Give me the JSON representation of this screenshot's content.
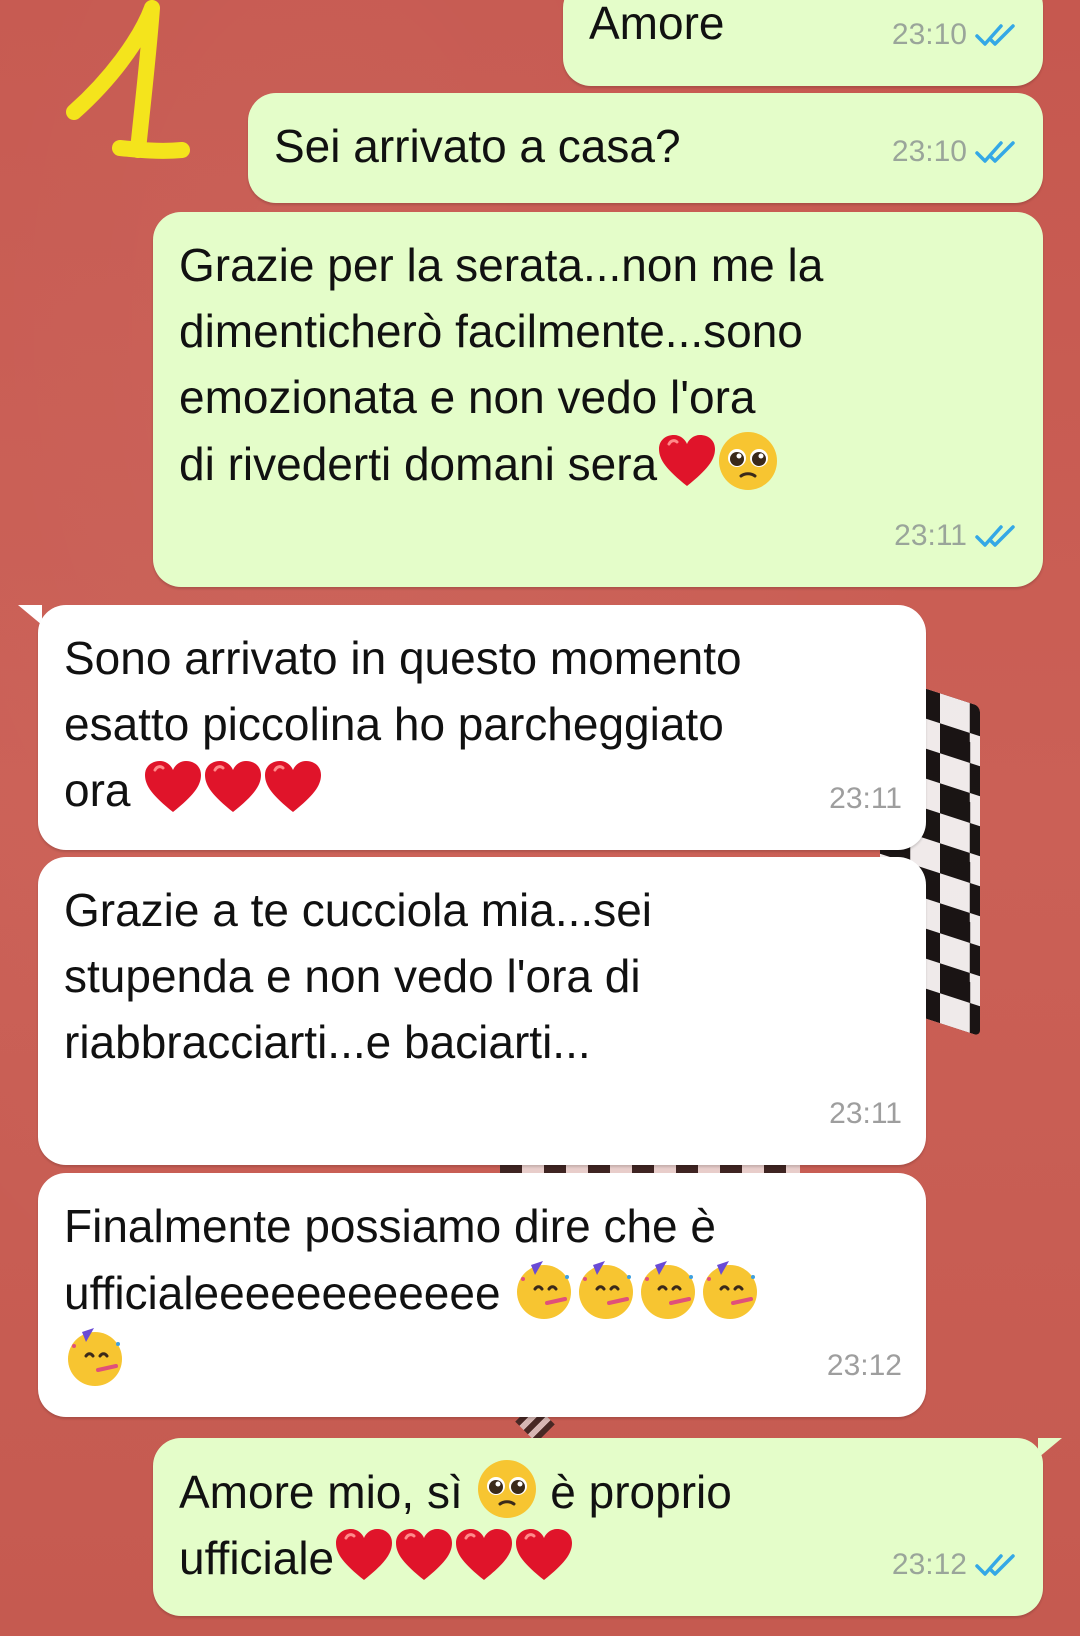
{
  "annotation": {
    "label": "1",
    "color": "#f4e41c"
  },
  "colors": {
    "background": "#c95f55",
    "outgoing_bubble": "#e4fdc9",
    "incoming_bubble": "#ffffff",
    "read_ticks": "#34a8e6"
  },
  "messages": [
    {
      "direction": "out",
      "text": "Amore",
      "time": "23:10",
      "status": "read"
    },
    {
      "direction": "out",
      "text": "Sei arrivato a casa?",
      "time": "23:10",
      "status": "read"
    },
    {
      "direction": "out",
      "lines": [
        "Grazie per la serata...non me la",
        "dimenticherò facilmente...sono",
        "emozionata e non vedo l'ora",
        "di rivederti domani sera"
      ],
      "trailing_emoji": [
        "heart",
        "pleading-face"
      ],
      "time": "23:11",
      "status": "read"
    },
    {
      "direction": "in",
      "lines": [
        "Sono arrivato in questo momento",
        "esatto piccolina ho parcheggiato",
        "ora "
      ],
      "trailing_emoji": [
        "heart",
        "heart",
        "heart"
      ],
      "time": "23:11"
    },
    {
      "direction": "in",
      "lines": [
        "Grazie a te cucciola mia...sei",
        "stupenda e non vedo l'ora di",
        "riabbracciarti...e baciarti..."
      ],
      "time": "23:11"
    },
    {
      "direction": "in",
      "lines": [
        "Finalmente possiamo dire che è",
        "ufficialeeeeeeeeeeee "
      ],
      "trailing_emoji": [
        "partying-face",
        "partying-face",
        "partying-face",
        "partying-face",
        "partying-face"
      ],
      "time": "23:12"
    },
    {
      "direction": "out",
      "line1_before": "Amore mio, sì ",
      "line1_emoji": "pleading-face",
      "line1_after": " è proprio",
      "line2": "ufficiale",
      "trailing_emoji": [
        "heart",
        "heart",
        "heart",
        "heart"
      ],
      "time": "23:12",
      "status": "read"
    }
  ]
}
